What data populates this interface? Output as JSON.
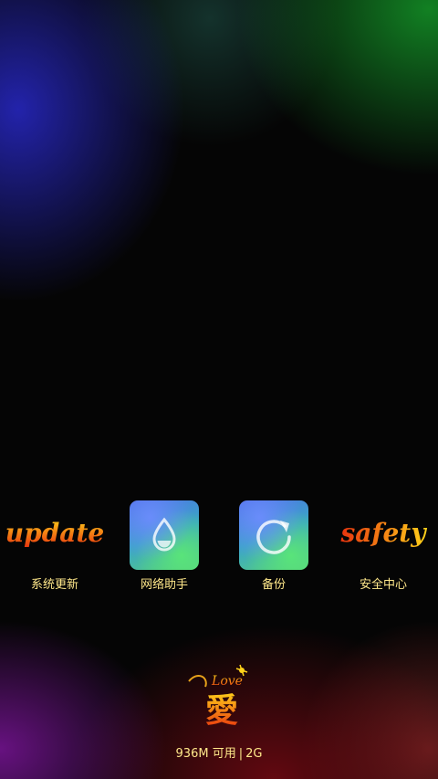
{
  "apps": [
    {
      "label": "系统更新",
      "art_text": "update",
      "icon": "update-wordart-icon"
    },
    {
      "label": "网络助手",
      "icon": "water-drop-icon"
    },
    {
      "label": "备份",
      "icon": "refresh-arrow-icon"
    },
    {
      "label": "安全中心",
      "art_text": "safety",
      "icon": "safety-wordart-icon"
    }
  ],
  "footer": {
    "logo_text": "Love",
    "logo_char": "愛",
    "memory": "936M 可用",
    "network": "2G"
  },
  "colors": {
    "label": "#ffe88a",
    "wordart_top": "#ffd21a",
    "wordart_bottom": "#e8320e"
  }
}
